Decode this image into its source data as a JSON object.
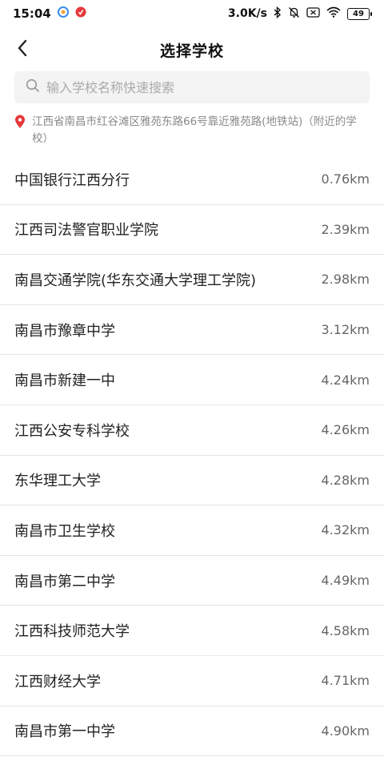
{
  "status_bar": {
    "time": "15:04",
    "net_speed": "3.0K/s",
    "battery": "49"
  },
  "header": {
    "title": "选择学校"
  },
  "search": {
    "placeholder": "输入学校名称快速搜索",
    "value": ""
  },
  "location": {
    "text": "江西省南昌市红谷滩区雅苑东路66号靠近雅苑路(地铁站)（附近的学校）",
    "pin_color": "#e5383b"
  },
  "schools": [
    {
      "name": "中国银行江西分行",
      "distance": "0.76km"
    },
    {
      "name": "江西司法警官职业学院",
      "distance": "2.39km"
    },
    {
      "name": "南昌交通学院(华东交通大学理工学院)",
      "distance": "2.98km"
    },
    {
      "name": "南昌市豫章中学",
      "distance": "3.12km"
    },
    {
      "name": "南昌市新建一中",
      "distance": "4.24km"
    },
    {
      "name": "江西公安专科学校",
      "distance": "4.26km"
    },
    {
      "name": "东华理工大学",
      "distance": "4.28km"
    },
    {
      "name": "南昌市卫生学校",
      "distance": "4.32km"
    },
    {
      "name": "南昌市第二中学",
      "distance": "4.49km"
    },
    {
      "name": "江西科技师范大学",
      "distance": "4.58km"
    },
    {
      "name": "江西财经大学",
      "distance": "4.71km"
    },
    {
      "name": "南昌市第一中学",
      "distance": "4.90km"
    }
  ]
}
